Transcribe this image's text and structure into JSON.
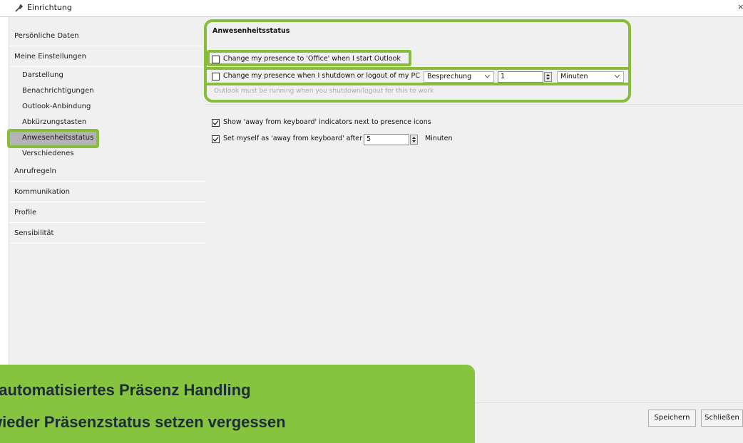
{
  "window": {
    "title": "Einrichtung",
    "close_glyph": "×"
  },
  "sidebar": {
    "items": [
      {
        "label": "Persönliche Daten"
      },
      {
        "label": "Meine Einstellungen"
      },
      {
        "label": "Anrufregeln"
      },
      {
        "label": "Kommunikation"
      },
      {
        "label": "Profile"
      },
      {
        "label": "Sensibilität"
      }
    ],
    "sub_items": [
      {
        "label": "Darstellung"
      },
      {
        "label": "Benachrichtigungen"
      },
      {
        "label": "Outlook-Anbindung"
      },
      {
        "label": "Abkürzungstasten"
      },
      {
        "label": "Anwesenheitsstatus",
        "selected": true
      },
      {
        "label": "Verschiedenes"
      }
    ]
  },
  "content": {
    "heading": "Anwesenheitsstatus",
    "office_on_start": {
      "label": "Change my presence to 'Office' when I start Outlook",
      "checked": false
    },
    "on_shutdown": {
      "label": "Change my presence when I shutdown or logout of my PC",
      "checked": false,
      "status_value": "Besprechung",
      "delay_value": "1",
      "unit_value": "Minuten"
    },
    "shutdown_hint": "Outlook must be running when you shutdown/logout for this to work",
    "afk_indicators": {
      "label": "Show 'away from keyboard' indicators next to presence icons",
      "checked": true
    },
    "afk_after": {
      "label": "Set myself as 'away from keyboard' after",
      "checked": true,
      "value": "5",
      "unit": "Minuten"
    }
  },
  "footer": {
    "save_label": "Speichern",
    "close_label": "Schließen"
  },
  "banner": {
    "line1": "l automatisiertes Präsenz Handling",
    "line2": "wieder Präsenzstatus setzen vergessen"
  },
  "colors": {
    "highlight_green": "#86bd3b",
    "banner_green": "#86c440"
  }
}
